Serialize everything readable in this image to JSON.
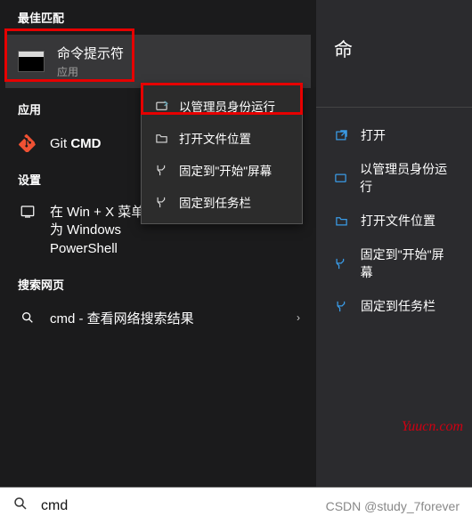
{
  "sections": {
    "best_match_header": "最佳匹配",
    "apps_header": "应用",
    "settings_header": "设置",
    "search_web_header": "搜索网页"
  },
  "best_match": {
    "title": "命令提示符",
    "subtitle": "应用"
  },
  "apps": {
    "git_cmd": "Git CMD"
  },
  "settings": {
    "winx_replace": "在 Win + X 菜单中换为 Windows PowerShell"
  },
  "search_web": {
    "cmd_label": "cmd - 查看网络搜索结果"
  },
  "context_menu": {
    "run_admin": "以管理员身份运行",
    "open_location": "打开文件位置",
    "pin_start": "固定到\"开始\"屏幕",
    "pin_taskbar": "固定到任务栏"
  },
  "right_panel": {
    "title_fragment": "命",
    "actions": {
      "open": "打开",
      "run_admin": "以管理员身份运行",
      "open_location": "打开文件位置",
      "pin_start": "固定到\"开始\"屏幕",
      "pin_taskbar": "固定到任务栏"
    }
  },
  "search": {
    "value": "cmd"
  },
  "watermarks": {
    "site": "Yuucn.com",
    "csdn": "CSDN @study_7forever"
  }
}
